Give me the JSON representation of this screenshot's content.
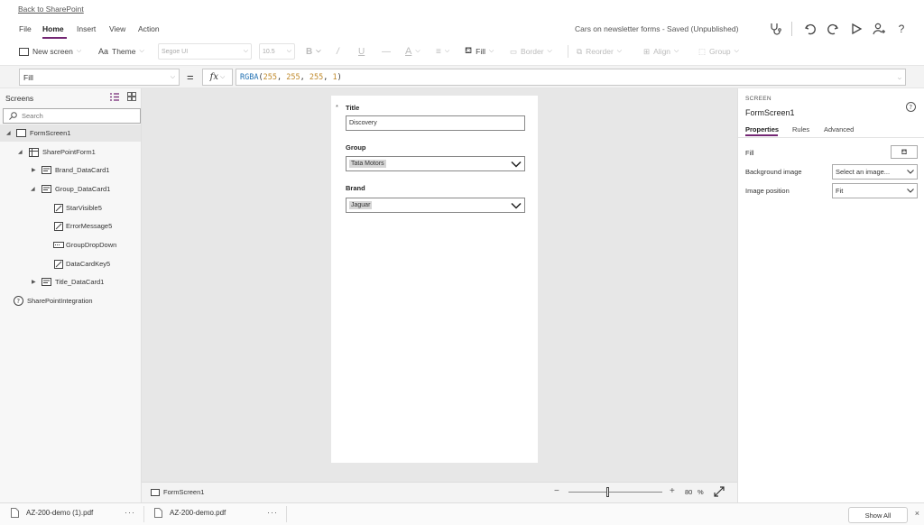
{
  "back_link": "Back to SharePoint",
  "menu": {
    "items": [
      "File",
      "Home",
      "Insert",
      "View",
      "Action"
    ],
    "active": "Home",
    "app_title": "Cars on newsletter forms - Saved (Unpublished)"
  },
  "toolbar": {
    "new_screen": "New screen",
    "theme": "Theme",
    "font": "Segoe UI",
    "font_size": "10.5",
    "fill": "Fill",
    "border": "Border",
    "reorder": "Reorder",
    "align": "Align",
    "group": "Group"
  },
  "formula_bar": {
    "property": "Fill",
    "equals": "=",
    "fx": "fx",
    "formula_fn": "RGBA",
    "formula_args": [
      "255",
      "255",
      "255",
      "1"
    ]
  },
  "left_panel": {
    "title": "Screens",
    "search_placeholder": "Search",
    "tree": [
      {
        "label": "FormScreen1"
      },
      {
        "label": "SharePointForm1"
      },
      {
        "label": "Brand_DataCard1"
      },
      {
        "label": "Group_DataCard1"
      },
      {
        "label": "StarVisible5"
      },
      {
        "label": "ErrorMessage5"
      },
      {
        "label": "GroupDropDown"
      },
      {
        "label": "DataCardKey5"
      },
      {
        "label": "Title_DataCard1"
      },
      {
        "label": "SharePointIntegration"
      }
    ]
  },
  "form": {
    "title_label": "Title",
    "title_required": "*",
    "title_value": "Discovery",
    "group_label": "Group",
    "group_value": "Tata Motors",
    "brand_label": "Brand",
    "brand_value": "Jaguar"
  },
  "status_bar": {
    "screen_name": "FormScreen1",
    "zoom_minus": "−",
    "zoom_plus": "+",
    "zoom_value": "80",
    "zoom_unit": "%"
  },
  "right_panel": {
    "type_label": "SCREEN",
    "screen_name": "FormScreen1",
    "tabs": [
      "Properties",
      "Rules",
      "Advanced"
    ],
    "fill_label": "Fill",
    "background_image_label": "Background image",
    "background_image_value": "Select an image...",
    "image_position_label": "Image position",
    "image_position_value": "Fit"
  },
  "downloads": {
    "items": [
      "AZ-200-demo (1).pdf",
      "AZ-200-demo.pdf"
    ],
    "more": "···",
    "show_all": "Show All"
  },
  "colors": {
    "accent": "#742774",
    "canvas_bg": "#e7e7e7",
    "formula_fn": "#1f6fb2",
    "formula_num": "#c08a2b"
  }
}
